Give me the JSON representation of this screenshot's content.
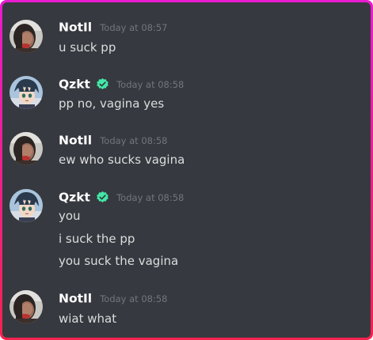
{
  "colors": {
    "frame_gradient_top": "#e81ccf",
    "frame_gradient_bottom": "#f5224e",
    "background": "#36393f",
    "username": "#ffffff",
    "timestamp": "#72767d",
    "message_text": "#dcddde",
    "verified_badge": "#43e8a7"
  },
  "messages": [
    {
      "author": "NotIl",
      "avatar_icon": "user-avatar-notil",
      "timestamp": "Today at 08:57",
      "verified": false,
      "lines": [
        "u suck pp"
      ]
    },
    {
      "author": "Qzkt",
      "avatar_icon": "user-avatar-qzkt",
      "timestamp": "Today at 08:58",
      "verified": true,
      "lines": [
        "pp no, vagina yes"
      ]
    },
    {
      "author": "NotIl",
      "avatar_icon": "user-avatar-notil",
      "timestamp": "Today at 08:58",
      "verified": false,
      "lines": [
        "ew who sucks vagina"
      ]
    },
    {
      "author": "Qzkt",
      "avatar_icon": "user-avatar-qzkt",
      "timestamp": "Today at 08:58",
      "verified": true,
      "lines": [
        "you",
        "i suck the pp",
        "you suck the vagina"
      ]
    },
    {
      "author": "NotIl",
      "avatar_icon": "user-avatar-notil",
      "timestamp": "Today at 08:58",
      "verified": false,
      "lines": [
        "wiat what"
      ]
    }
  ]
}
